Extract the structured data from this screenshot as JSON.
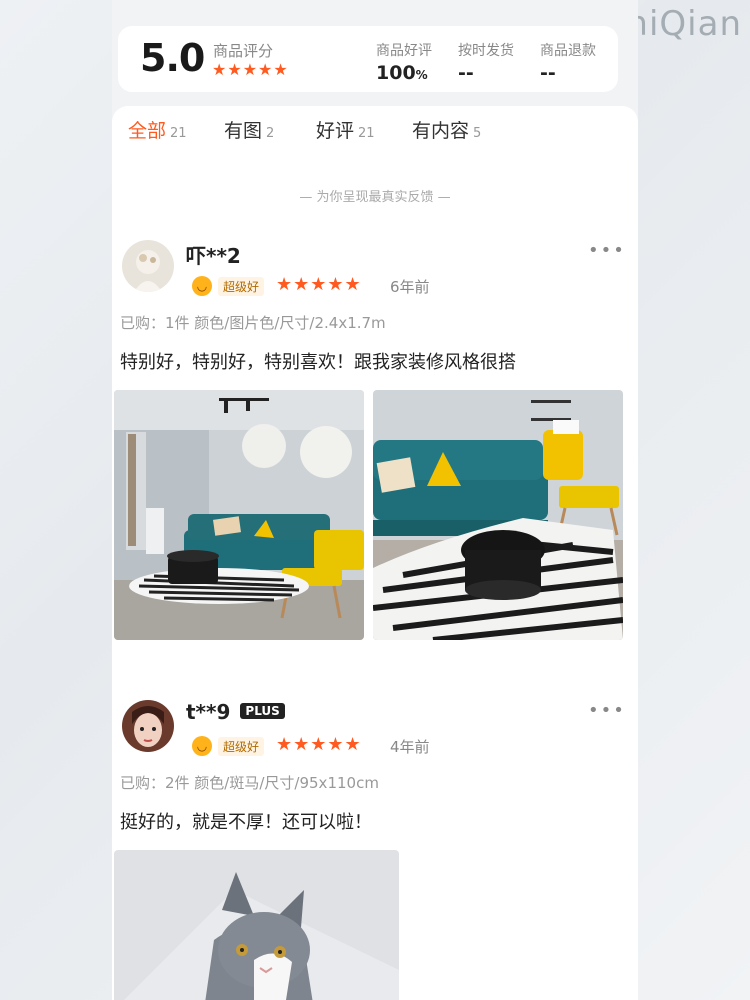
{
  "watermark": "XinZhiQian",
  "summary": {
    "score": "5.0",
    "score_label": "商品评分",
    "stars": "★★★★★",
    "metrics": [
      {
        "label": "商品好评",
        "value": "100",
        "unit": "%"
      },
      {
        "label": "按时发货",
        "value": "--"
      },
      {
        "label": "商品退款",
        "value": "--"
      }
    ]
  },
  "tabs": [
    {
      "label": "全部",
      "count": "21"
    },
    {
      "label": "有图",
      "count": "2"
    },
    {
      "label": "好评",
      "count": "21"
    },
    {
      "label": "有内容",
      "count": "5"
    }
  ],
  "notice": "— 为你呈现最真实反馈 —",
  "reviews": [
    {
      "user": "吓**2",
      "badge": "超级好",
      "stars": "★★★★★",
      "time": "6年前",
      "purchase": "已购：1件  颜色/图片色/尺寸/2.4x1.7m",
      "content": "特别好，特别好，特别喜欢！跟我家装修风格很搭",
      "more": "•••"
    },
    {
      "user": "t**9",
      "tag": "PLUS",
      "badge": "超级好",
      "stars": "★★★★★",
      "time": "4年前",
      "purchase": "已购：2件  颜色/斑马/尺寸/95x110cm",
      "content": "挺好的，就是不厚！还可以啦！",
      "more": "•••"
    }
  ],
  "colors": {
    "accent": "#ff5a1f",
    "sofa": "#1f6f7a",
    "yellow": "#f2c200"
  }
}
